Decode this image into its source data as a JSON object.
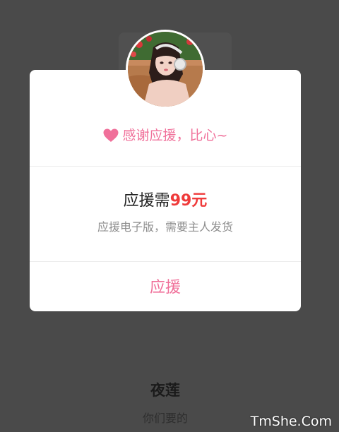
{
  "modal": {
    "thanks_text": "感谢应援，比心~",
    "price_prefix": "应援需",
    "price_amount": "99元",
    "description": "应援电子版，需要主人发货",
    "support_button_label": "应援"
  },
  "profile": {
    "name": "夜莲",
    "bio": "你们要的"
  },
  "watermark": "TmShe.Com",
  "colors": {
    "overlay": "#4a4a4a",
    "accent_pink": "#f0709a",
    "price_red": "#ef3a3a",
    "secondary_text": "#8d8d8d"
  },
  "icons": {
    "heart": "heart-icon",
    "avatar": "avatar"
  }
}
